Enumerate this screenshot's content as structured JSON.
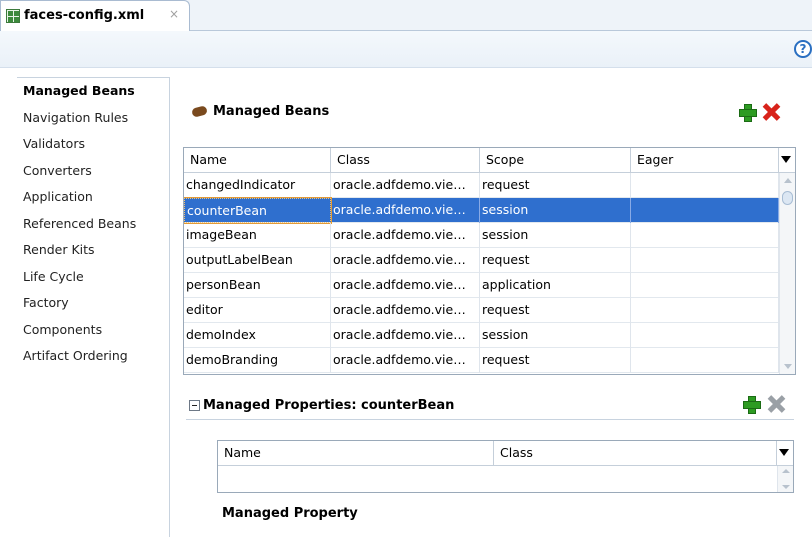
{
  "tab": {
    "title": "faces-config.xml",
    "close_glyph": "×"
  },
  "toolbar": {
    "help_glyph": "?"
  },
  "nav": {
    "items": [
      {
        "label": "Managed Beans",
        "active": true
      },
      {
        "label": "Navigation Rules"
      },
      {
        "label": "Validators"
      },
      {
        "label": "Converters"
      },
      {
        "label": "Application"
      },
      {
        "label": "Referenced Beans"
      },
      {
        "label": "Render Kits"
      },
      {
        "label": "Life Cycle"
      },
      {
        "label": "Factory"
      },
      {
        "label": "Components"
      },
      {
        "label": "Artifact Ordering"
      }
    ]
  },
  "beans": {
    "title": "Managed Beans",
    "columns": [
      "Name",
      "Class",
      "Scope",
      "Eager"
    ],
    "rows": [
      {
        "name": "changedIndicator",
        "class": "oracle.adfdemo.vie…",
        "scope": "request",
        "eager": ""
      },
      {
        "name": "counterBean",
        "class": "oracle.adfdemo.vie…",
        "scope": "session",
        "eager": "",
        "selected": true
      },
      {
        "name": "imageBean",
        "class": "oracle.adfdemo.vie…",
        "scope": "session",
        "eager": ""
      },
      {
        "name": "outputLabelBean",
        "class": "oracle.adfdemo.vie…",
        "scope": "request",
        "eager": ""
      },
      {
        "name": "personBean",
        "class": "oracle.adfdemo.vie…",
        "scope": "application",
        "eager": ""
      },
      {
        "name": "editor",
        "class": "oracle.adfdemo.vie…",
        "scope": "request",
        "eager": ""
      },
      {
        "name": "demoIndex",
        "class": "oracle.adfdemo.vie…",
        "scope": "session",
        "eager": ""
      },
      {
        "name": "demoBranding",
        "class": "oracle.adfdemo.vie…",
        "scope": "request",
        "eager": ""
      }
    ]
  },
  "properties": {
    "title": "Managed Properties: counterBean",
    "columns": [
      "Name",
      "Class"
    ]
  },
  "managed_property": {
    "label": "Managed Property"
  },
  "colors": {
    "selection": "#2f6fce",
    "add": "#2d9b22",
    "remove": "#d8231a"
  }
}
